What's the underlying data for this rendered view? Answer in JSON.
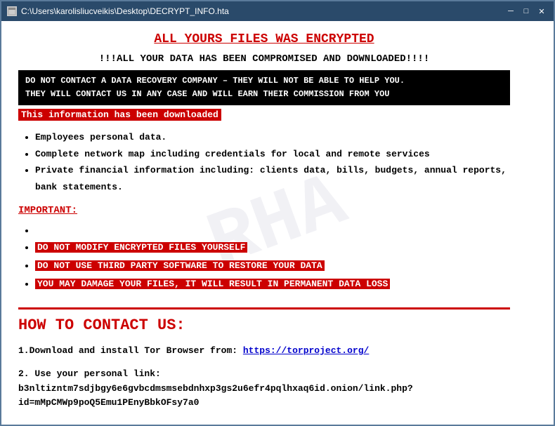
{
  "window": {
    "title": "C:\\Users\\karolisliucveikis\\Desktop\\DECRYPT_INFO.hta",
    "controls": {
      "minimize": "─",
      "maximize": "□",
      "close": "✕"
    }
  },
  "content": {
    "main_title": "ALL YOURS FILES WAS ENCRYPTED",
    "subtitle": "!!!ALL YOUR DATA HAS BEEN COMPROMISED AND DOWNLOADED!!!!",
    "warning_line1": "DO NOT CONTACT A DATA RECOVERY COMPANY – THEY WILL NOT BE ABLE TO HELP YOU.",
    "warning_line2": "THEY WILL CONTACT US IN ANY CASE AND WILL EARN THEIR COMMISSION FROM YOU",
    "info_downloaded": "This information has been downloaded",
    "bullet_items": [
      "Employees personal data.",
      "Complete network map including credentials for local and remote services",
      "Private financial information including: clients data, bills, budgets, annual reports, bank statements."
    ],
    "important_label": "IMPORTANT:",
    "important_items": [
      "",
      "DO NOT MODIFY ENCRYPTED FILES YOURSELF",
      "DO NOT USE THIRD PARTY SOFTWARE TO RESTORE YOUR DATA",
      "YOU MAY DAMAGE YOUR FILES, IT WILL RESULT IN PERMANENT DATA LOSS"
    ],
    "how_to_title": "HOW TO CONTACT US:",
    "step1_label": "1.Download and install Tor Browser from:",
    "step1_link_text": "https://torproject.org/",
    "step1_link_href": "https://torproject.org/",
    "step2_label": "2. Use your personal link:",
    "step2_link": "b3nltizntm7sdjbgy6e6gvbcdmsmsebdnhxp3gs2u6efr4pqlhxaq6id.onion/link.php?id=mMpCMWp9poQ5Emu1PEnyBbkOFsy7a0",
    "watermark": "RHA"
  }
}
